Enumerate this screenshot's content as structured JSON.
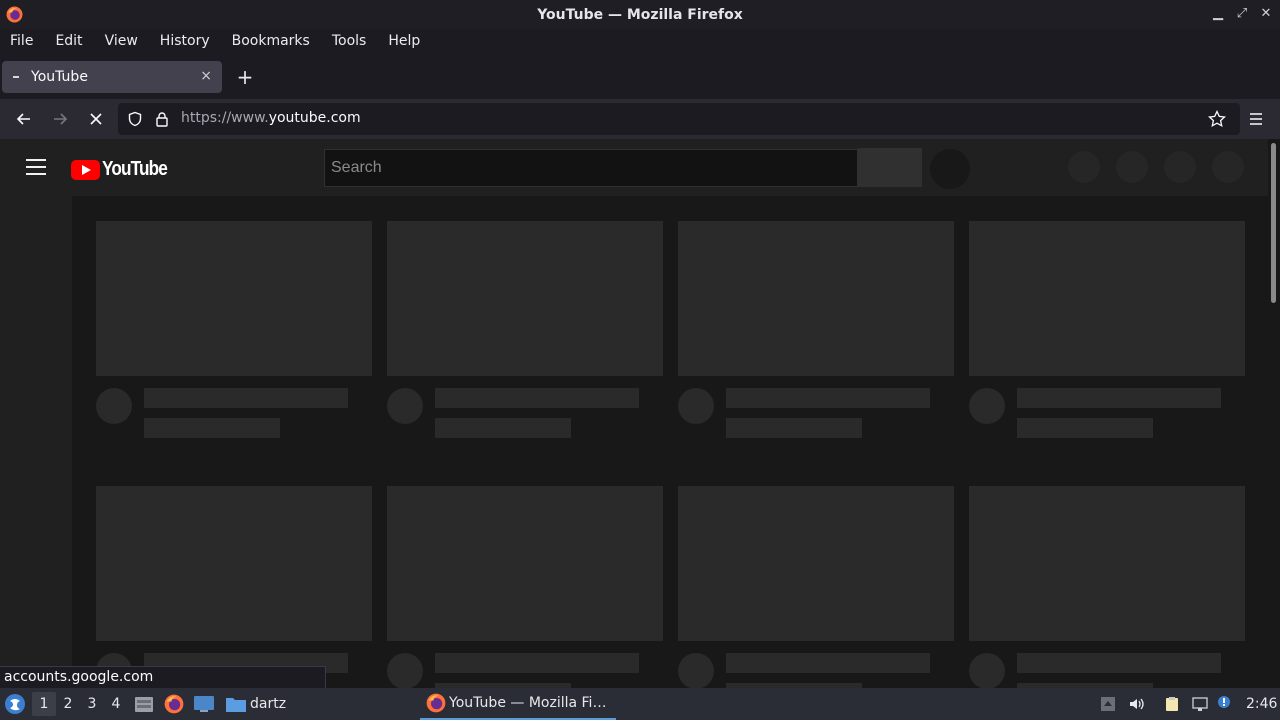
{
  "window": {
    "title": "YouTube — Mozilla Firefox"
  },
  "menubar": {
    "items": [
      "File",
      "Edit",
      "View",
      "History",
      "Bookmarks",
      "Tools",
      "Help"
    ]
  },
  "tab": {
    "title": "YouTube",
    "close": "×",
    "new_tab": "+"
  },
  "navbar": {
    "url_scheme": "https://www.",
    "url_host": "youtube.com"
  },
  "youtube": {
    "logo_text": "YouTube",
    "search_placeholder": "Search",
    "brand_color": "#ff0000"
  },
  "status": {
    "text": "accounts.google.com"
  },
  "taskbar": {
    "workspaces": [
      "1",
      "2",
      "3",
      "4"
    ],
    "folder_label": "dartz",
    "task_label": "YouTube — Mozilla Fi…",
    "clock": "2:46"
  }
}
